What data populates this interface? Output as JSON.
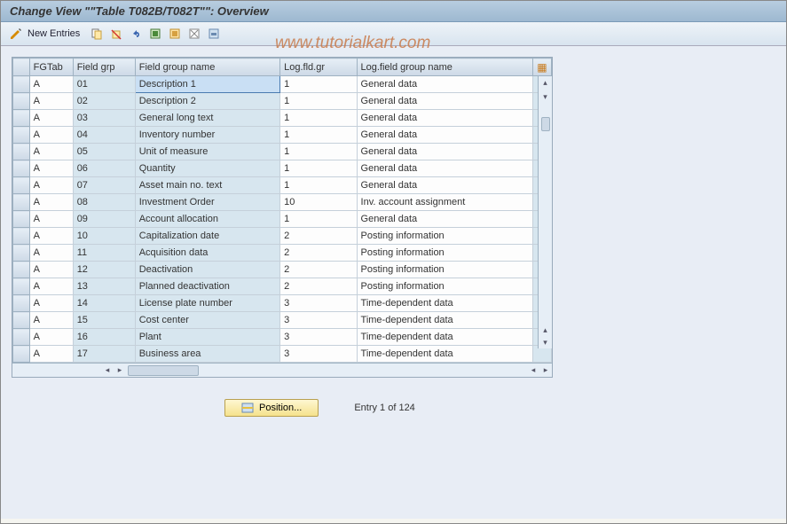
{
  "title": "Change View \"\"Table T082B/T082T\"\": Overview",
  "watermark": "www.tutorialkart.com",
  "toolbar": {
    "new_entries": "New Entries"
  },
  "columns": {
    "fgtab": "FGTab",
    "field_grp": "Field grp",
    "field_group_name": "Field group name",
    "log_fld_gr": "Log.fld.gr",
    "log_field_group_name": "Log.field group name"
  },
  "rows": [
    {
      "fgtab": "A",
      "grp": "01",
      "name": "Description 1",
      "loggr": "1",
      "logname": "General data",
      "selected": true
    },
    {
      "fgtab": "A",
      "grp": "02",
      "name": "Description 2",
      "loggr": "1",
      "logname": "General data"
    },
    {
      "fgtab": "A",
      "grp": "03",
      "name": "General long text",
      "loggr": "1",
      "logname": "General data"
    },
    {
      "fgtab": "A",
      "grp": "04",
      "name": "Inventory number",
      "loggr": "1",
      "logname": "General data"
    },
    {
      "fgtab": "A",
      "grp": "05",
      "name": "Unit of measure",
      "loggr": "1",
      "logname": "General data"
    },
    {
      "fgtab": "A",
      "grp": "06",
      "name": "Quantity",
      "loggr": "1",
      "logname": "General data"
    },
    {
      "fgtab": "A",
      "grp": "07",
      "name": "Asset main no. text",
      "loggr": "1",
      "logname": "General data"
    },
    {
      "fgtab": "A",
      "grp": "08",
      "name": "Investment Order",
      "loggr": "10",
      "logname": "Inv. account assignment"
    },
    {
      "fgtab": "A",
      "grp": "09",
      "name": "Account allocation",
      "loggr": "1",
      "logname": "General data"
    },
    {
      "fgtab": "A",
      "grp": "10",
      "name": "Capitalization date",
      "loggr": "2",
      "logname": "Posting information"
    },
    {
      "fgtab": "A",
      "grp": "11",
      "name": "Acquisition data",
      "loggr": "2",
      "logname": "Posting information"
    },
    {
      "fgtab": "A",
      "grp": "12",
      "name": "Deactivation",
      "loggr": "2",
      "logname": "Posting information"
    },
    {
      "fgtab": "A",
      "grp": "13",
      "name": "Planned deactivation",
      "loggr": "2",
      "logname": "Posting information"
    },
    {
      "fgtab": "A",
      "grp": "14",
      "name": "License plate number",
      "loggr": "3",
      "logname": "Time-dependent data"
    },
    {
      "fgtab": "A",
      "grp": "15",
      "name": "Cost center",
      "loggr": "3",
      "logname": "Time-dependent data"
    },
    {
      "fgtab": "A",
      "grp": "16",
      "name": "Plant",
      "loggr": "3",
      "logname": "Time-dependent data"
    },
    {
      "fgtab": "A",
      "grp": "17",
      "name": "Business area",
      "loggr": "3",
      "logname": "Time-dependent data"
    }
  ],
  "footer": {
    "position_label": "Position...",
    "entry_info": "Entry 1 of 124"
  }
}
